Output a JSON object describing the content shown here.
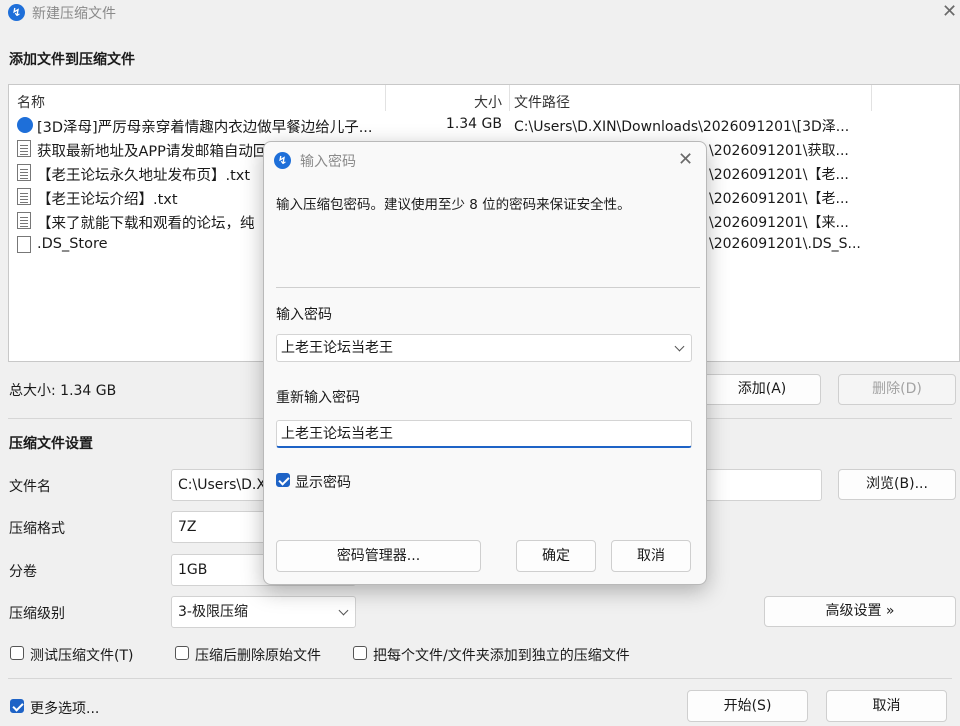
{
  "window": {
    "title": "新建压缩文件",
    "section_add": "添加文件到压缩文件"
  },
  "file_list": {
    "columns": [
      "名称",
      "大小",
      "文件路径"
    ],
    "rows": [
      {
        "name": "[3D泽母]严厉母亲穿着情趣内衣边做早餐边给儿子...",
        "size": "1.34 GB",
        "path": "C:\\Users\\D.XIN\\Downloads\\2026091201\\[3D泽...",
        "icon": "app-file-icon"
      },
      {
        "name": "获取最新地址及APP请发邮箱自动回",
        "size": "",
        "path": "\\2026091201\\获取...",
        "icon": "text-file-icon"
      },
      {
        "name": "【老王论坛永久地址发布页】.txt",
        "size": "",
        "path": "\\2026091201\\【老...",
        "icon": "text-file-icon"
      },
      {
        "name": "【老王论坛介绍】.txt",
        "size": "",
        "path": "\\2026091201\\【老...",
        "icon": "text-file-icon"
      },
      {
        "name": "【来了就能下载和观看的论坛，纯",
        "size": "",
        "path": "\\2026091201\\【来...",
        "icon": "text-file-icon"
      },
      {
        "name": ".DS_Store",
        "size": "",
        "path": "\\2026091201\\.DS_S...",
        "icon": "blank-file-icon"
      }
    ]
  },
  "summary": {
    "total_size": "总大小: 1.34 GB",
    "add_button": "添加(A)",
    "delete_button": "删除(D)"
  },
  "settings": {
    "heading": "压缩文件设置",
    "filename_label": "文件名",
    "filename_value": "C:\\Users\\D.X",
    "browse_button": "浏览(B)...",
    "format_label": "压缩格式",
    "format_value": "7Z",
    "split_label": "分卷",
    "split_value": "1GB",
    "level_label": "压缩级别",
    "level_value": "3-极限压缩",
    "advanced_button": "高级设置 »",
    "test_checkbox": "测试压缩文件(T)",
    "delete_after_checkbox": "压缩后删除原始文件",
    "separate_checkbox": "把每个文件/文件夹添加到独立的压缩文件",
    "more_options": "更多选项...",
    "start_button": "开始(S)",
    "cancel_button": "取消"
  },
  "password_dialog": {
    "title": "输入密码",
    "description": "输入压缩包密码。建议使用至少 8 位的密码来保证安全性。",
    "password_label": "输入密码",
    "password_value": "上老王论坛当老王",
    "confirm_label": "重新输入密码",
    "confirm_value": "上老王论坛当老王",
    "show_password": "显示密码",
    "show_password_checked": true,
    "manager_button": "密码管理器...",
    "ok_button": "确定",
    "cancel_button": "取消"
  },
  "colors": {
    "accent": "#1e63c6",
    "app_icon": "#1e6fd9"
  }
}
